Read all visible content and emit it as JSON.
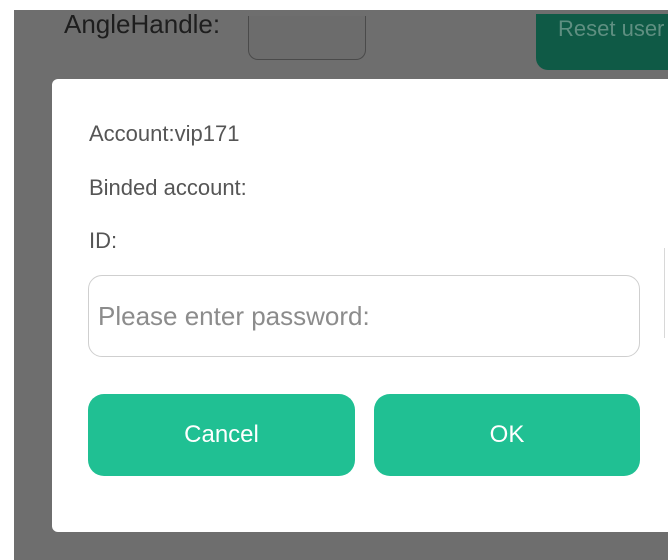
{
  "background": {
    "field_label": "AngleHandle:",
    "reset_button_label": "Reset user"
  },
  "dialog": {
    "account_line": "Account:vip171",
    "binded_account_line": "Binded account:",
    "id_line": "ID:",
    "password_placeholder": "Please enter password:",
    "password_value": "",
    "cancel_label": "Cancel",
    "ok_label": "OK"
  },
  "colors": {
    "accent": "#20c093",
    "overlay": "#6e6e6e",
    "dark_accent": "#0f5a46"
  }
}
